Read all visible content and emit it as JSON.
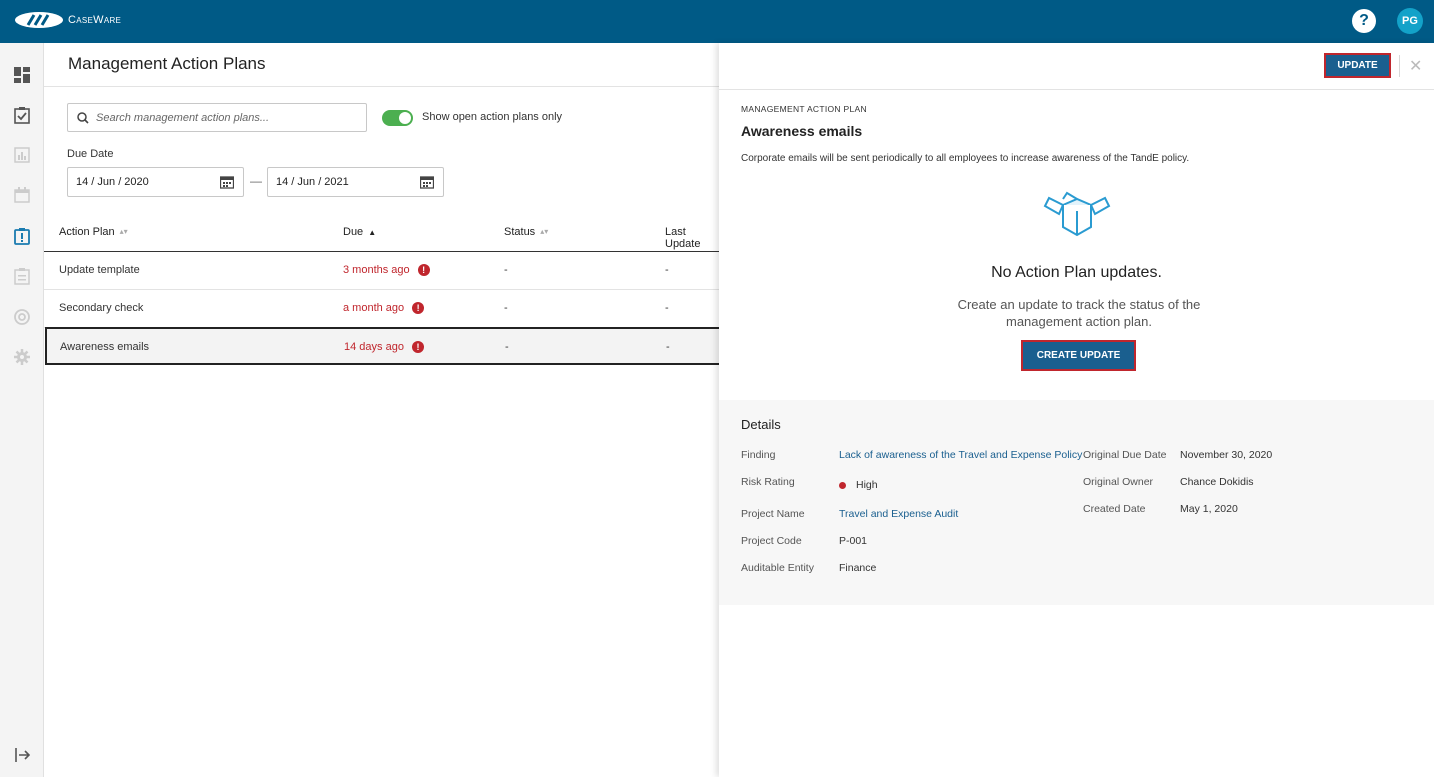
{
  "app": {
    "brand": "CaseWare",
    "avatar_initials": "PG",
    "help_label": "?"
  },
  "rail": {
    "items": [
      "dashboard-icon",
      "checklist-icon",
      "chart-icon",
      "calendar-icon",
      "alert-icon",
      "document-icon",
      "support-icon",
      "settings-icon",
      "logout-icon"
    ]
  },
  "list": {
    "title": "Management Action Plans",
    "search_placeholder": "Search management action plans...",
    "toggle_label": "Show open action plans only",
    "toggle_on": true,
    "due_date_label": "Due Date",
    "date_from": "14 / Jun / 2020",
    "date_to": "14 / Jun / 2021",
    "date_separator": "—",
    "columns": {
      "plan": "Action Plan",
      "due": "Due",
      "status": "Status",
      "last_update": "Last Update"
    },
    "rows": [
      {
        "plan": "Update template",
        "due": "3 months ago",
        "status": "-",
        "last_update": "-"
      },
      {
        "plan": "Secondary check",
        "due": "a month ago",
        "status": "-",
        "last_update": "-"
      },
      {
        "plan": "Awareness emails",
        "due": "14 days ago",
        "status": "-",
        "last_update": "-"
      }
    ],
    "alert_glyph": "!"
  },
  "panel": {
    "update_label": "UPDATE",
    "close_label": "✕",
    "eyebrow": "MANAGEMENT ACTION PLAN",
    "title": "Awareness emails",
    "description": "Corporate emails will be sent periodically to all employees to increase awareness of the TandE policy.",
    "empty_title": "No Action Plan updates.",
    "empty_desc": "Create an update to track the status of the management action plan.",
    "create_label": "CREATE UPDATE",
    "details": {
      "title": "Details",
      "finding_label": "Finding",
      "finding_value": "Lack of awareness of the Travel and Expense Policy",
      "risk_label": "Risk Rating",
      "risk_value": "High",
      "risk_color": "#c0262d",
      "project_name_label": "Project Name",
      "project_name_value": "Travel and Expense Audit",
      "project_code_label": "Project Code",
      "project_code_value": "P-001",
      "entity_label": "Auditable Entity",
      "entity_value": "Finance",
      "orig_due_label": "Original Due Date",
      "orig_due_value": "November 30, 2020",
      "orig_owner_label": "Original Owner",
      "orig_owner_value": "Chance Dokidis",
      "created_label": "Created Date",
      "created_value": "May 1, 2020"
    }
  },
  "colors": {
    "topbar": "#005a86",
    "accent": "#1a5f8f",
    "danger": "#c0262d",
    "toggle": "#4caf50",
    "avatar": "#13a2c9"
  }
}
